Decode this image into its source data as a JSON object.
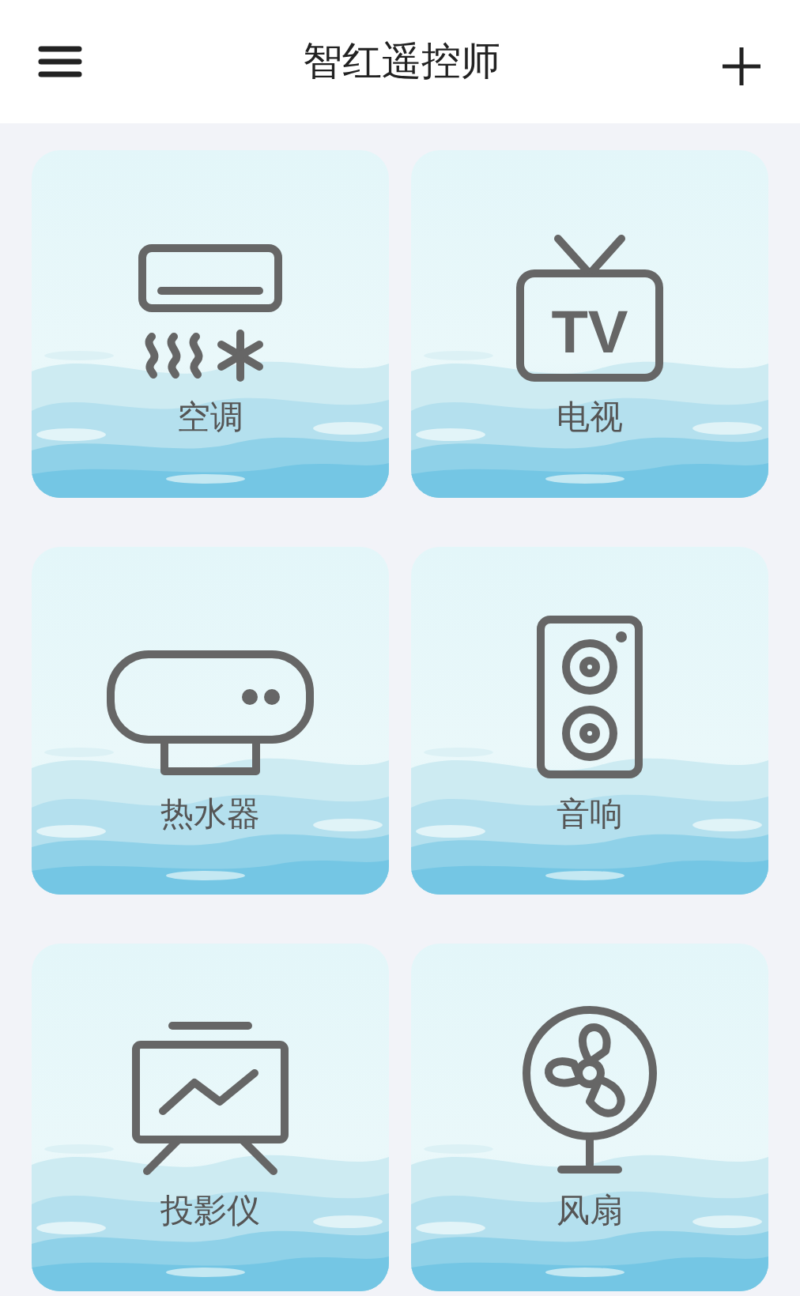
{
  "header": {
    "title": "智红遥控师"
  },
  "devices": [
    {
      "kind": "ac",
      "label": "空调"
    },
    {
      "kind": "tv",
      "label": "电视"
    },
    {
      "kind": "heater",
      "label": "热水器"
    },
    {
      "kind": "speaker",
      "label": "音响"
    },
    {
      "kind": "projector",
      "label": "投影仪"
    },
    {
      "kind": "fan",
      "label": "风扇"
    }
  ],
  "tv_icon": {
    "screen_text": "TV"
  }
}
